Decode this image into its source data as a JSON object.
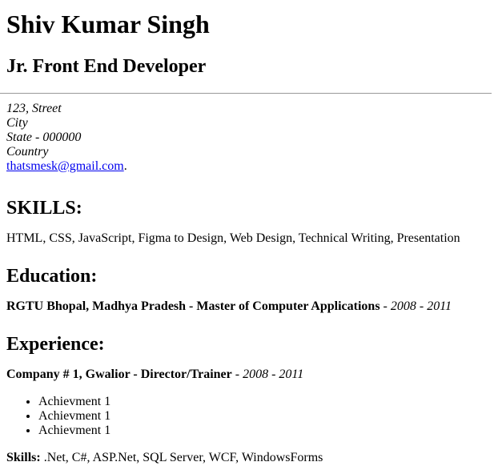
{
  "header": {
    "name": "Shiv Kumar Singh",
    "role": "Jr. Front End Developer"
  },
  "address": {
    "street": "123, Street",
    "city": "City",
    "state": "State - 000000",
    "country": "Country",
    "email": "thatsmesk@gmail.com",
    "email_suffix": "."
  },
  "skills": {
    "heading": "SKILLS:",
    "text": "HTML, CSS, JavaScript, Figma to Design, Web Design, Technical Writing, Presentation"
  },
  "education": {
    "heading": "Education:",
    "entry": "RGTU Bhopal, Madhya Pradesh - Master of Computer Applications",
    "separator": " - ",
    "dates": "2008 - 2011"
  },
  "experience": {
    "heading": "Experience:",
    "entry": "Company # 1, Gwalior - Director/Trainer",
    "separator": " - ",
    "dates": "2008 - 2011",
    "achievements": [
      "Achievment 1",
      "Achievment 1",
      "Achievment 1"
    ],
    "skills_label": "Skills:",
    "skills_text": " .Net, C#, ASP.Net, SQL Server, WCF, WindowsForms"
  }
}
